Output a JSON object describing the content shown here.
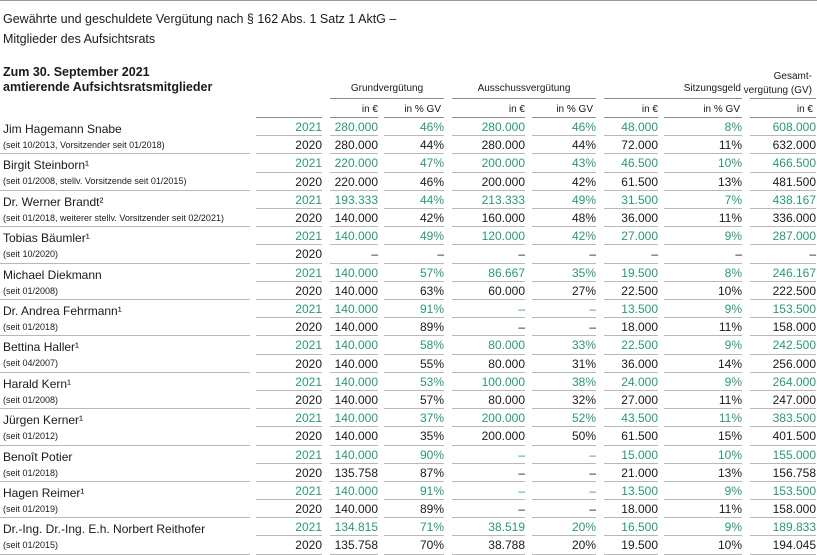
{
  "document": {
    "title_line1": "Gewährte und geschuldete Vergütung nach § 162 Abs. 1 Satz 1 AktG –",
    "title_line2": "Mitglieder des Aufsichtsrats",
    "section_line1": "Zum 30. September 2021",
    "section_line2": "amtierende Aufsichtsratsmitglieder"
  },
  "header": {
    "groups": [
      "Grundvergütung",
      "Ausschussvergütung",
      "Sitzungsgeld"
    ],
    "total_line1": "Gesamt-",
    "total_line2": "vergütung (GV)",
    "unit_eur": "in €",
    "unit_pct": "in % GV"
  },
  "colors": {
    "current_year": "#2a9a6b",
    "prior_year": "#1a1a1a",
    "rule": "#8c8c8c"
  },
  "members": [
    {
      "name": "Jim Hagemann Snabe",
      "sub": "(seit 10/2013, Vorsitzender seit 01/2018)",
      "rows": [
        {
          "year": "2021",
          "grund": "280.000",
          "grund_pct": "46%",
          "auss": "280.000",
          "auss_pct": "46%",
          "sitz": "48.000",
          "sitz_pct": "8%",
          "total": "608.000"
        },
        {
          "year": "2020",
          "grund": "280.000",
          "grund_pct": "44%",
          "auss": "280.000",
          "auss_pct": "44%",
          "sitz": "72.000",
          "sitz_pct": "11%",
          "total": "632.000"
        }
      ]
    },
    {
      "name": "Birgit Steinborn¹",
      "sub": "(seit 01/2008, stellv. Vorsitzende seit 01/2015)",
      "rows": [
        {
          "year": "2021",
          "grund": "220.000",
          "grund_pct": "47%",
          "auss": "200.000",
          "auss_pct": "43%",
          "sitz": "46.500",
          "sitz_pct": "10%",
          "total": "466.500"
        },
        {
          "year": "2020",
          "grund": "220.000",
          "grund_pct": "46%",
          "auss": "200.000",
          "auss_pct": "42%",
          "sitz": "61.500",
          "sitz_pct": "13%",
          "total": "481.500"
        }
      ]
    },
    {
      "name": "Dr. Werner Brandt²",
      "sub": "(seit 01/2018, weiterer stellv. Vorsitzender seit 02/2021)",
      "rows": [
        {
          "year": "2021",
          "grund": "193.333",
          "grund_pct": "44%",
          "auss": "213.333",
          "auss_pct": "49%",
          "sitz": "31.500",
          "sitz_pct": "7%",
          "total": "438.167"
        },
        {
          "year": "2020",
          "grund": "140.000",
          "grund_pct": "42%",
          "auss": "160.000",
          "auss_pct": "48%",
          "sitz": "36.000",
          "sitz_pct": "11%",
          "total": "336.000"
        }
      ]
    },
    {
      "name": "Tobias Bäumler¹",
      "sub": "(seit 10/2020)",
      "rows": [
        {
          "year": "2021",
          "grund": "140.000",
          "grund_pct": "49%",
          "auss": "120.000",
          "auss_pct": "42%",
          "sitz": "27.000",
          "sitz_pct": "9%",
          "total": "287.000"
        },
        {
          "year": "2020",
          "grund": "–",
          "grund_pct": "–",
          "auss": "–",
          "auss_pct": "–",
          "sitz": "–",
          "sitz_pct": "–",
          "total": "–"
        }
      ]
    },
    {
      "name": "Michael Diekmann",
      "sub": "(seit 01/2008)",
      "rows": [
        {
          "year": "2021",
          "grund": "140.000",
          "grund_pct": "57%",
          "auss": "86.667",
          "auss_pct": "35%",
          "sitz": "19.500",
          "sitz_pct": "8%",
          "total": "246.167"
        },
        {
          "year": "2020",
          "grund": "140.000",
          "grund_pct": "63%",
          "auss": "60.000",
          "auss_pct": "27%",
          "sitz": "22.500",
          "sitz_pct": "10%",
          "total": "222.500"
        }
      ]
    },
    {
      "name": "Dr. Andrea Fehrmann¹",
      "sub": "(seit 01/2018)",
      "rows": [
        {
          "year": "2021",
          "grund": "140.000",
          "grund_pct": "91%",
          "auss": "–",
          "auss_pct": "–",
          "sitz": "13.500",
          "sitz_pct": "9%",
          "total": "153.500"
        },
        {
          "year": "2020",
          "grund": "140.000",
          "grund_pct": "89%",
          "auss": "–",
          "auss_pct": "–",
          "sitz": "18.000",
          "sitz_pct": "11%",
          "total": "158.000"
        }
      ]
    },
    {
      "name": "Bettina Haller¹",
      "sub": "(seit 04/2007)",
      "rows": [
        {
          "year": "2021",
          "grund": "140.000",
          "grund_pct": "58%",
          "auss": "80.000",
          "auss_pct": "33%",
          "sitz": "22.500",
          "sitz_pct": "9%",
          "total": "242.500"
        },
        {
          "year": "2020",
          "grund": "140.000",
          "grund_pct": "55%",
          "auss": "80.000",
          "auss_pct": "31%",
          "sitz": "36.000",
          "sitz_pct": "14%",
          "total": "256.000"
        }
      ]
    },
    {
      "name": "Harald Kern¹",
      "sub": "(seit 01/2008)",
      "rows": [
        {
          "year": "2021",
          "grund": "140.000",
          "grund_pct": "53%",
          "auss": "100.000",
          "auss_pct": "38%",
          "sitz": "24.000",
          "sitz_pct": "9%",
          "total": "264.000"
        },
        {
          "year": "2020",
          "grund": "140.000",
          "grund_pct": "57%",
          "auss": "80.000",
          "auss_pct": "32%",
          "sitz": "27.000",
          "sitz_pct": "11%",
          "total": "247.000"
        }
      ]
    },
    {
      "name": "Jürgen Kerner¹",
      "sub": "(seit 01/2012)",
      "rows": [
        {
          "year": "2021",
          "grund": "140.000",
          "grund_pct": "37%",
          "auss": "200.000",
          "auss_pct": "52%",
          "sitz": "43.500",
          "sitz_pct": "11%",
          "total": "383.500"
        },
        {
          "year": "2020",
          "grund": "140.000",
          "grund_pct": "35%",
          "auss": "200.000",
          "auss_pct": "50%",
          "sitz": "61.500",
          "sitz_pct": "15%",
          "total": "401.500"
        }
      ]
    },
    {
      "name": "Benoît Potier",
      "sub": "(seit 01/2018)",
      "rows": [
        {
          "year": "2021",
          "grund": "140.000",
          "grund_pct": "90%",
          "auss": "–",
          "auss_pct": "–",
          "sitz": "15.000",
          "sitz_pct": "10%",
          "total": "155.000"
        },
        {
          "year": "2020",
          "grund": "135.758",
          "grund_pct": "87%",
          "auss": "–",
          "auss_pct": "–",
          "sitz": "21.000",
          "sitz_pct": "13%",
          "total": "156.758"
        }
      ]
    },
    {
      "name": "Hagen Reimer¹",
      "sub": "(seit 01/2019)",
      "rows": [
        {
          "year": "2021",
          "grund": "140.000",
          "grund_pct": "91%",
          "auss": "–",
          "auss_pct": "–",
          "sitz": "13.500",
          "sitz_pct": "9%",
          "total": "153.500"
        },
        {
          "year": "2020",
          "grund": "140.000",
          "grund_pct": "89%",
          "auss": "–",
          "auss_pct": "–",
          "sitz": "18.000",
          "sitz_pct": "11%",
          "total": "158.000"
        }
      ]
    },
    {
      "name": "Dr.-Ing. Dr.-Ing. E.h. Norbert Reithofer",
      "sub": "(seit 01/2015)",
      "rows": [
        {
          "year": "2021",
          "grund": "134.815",
          "grund_pct": "71%",
          "auss": "38.519",
          "auss_pct": "20%",
          "sitz": "16.500",
          "sitz_pct": "9%",
          "total": "189.833"
        },
        {
          "year": "2020",
          "grund": "135.758",
          "grund_pct": "70%",
          "auss": "38.788",
          "auss_pct": "20%",
          "sitz": "19.500",
          "sitz_pct": "10%",
          "total": "194.045"
        }
      ]
    }
  ]
}
